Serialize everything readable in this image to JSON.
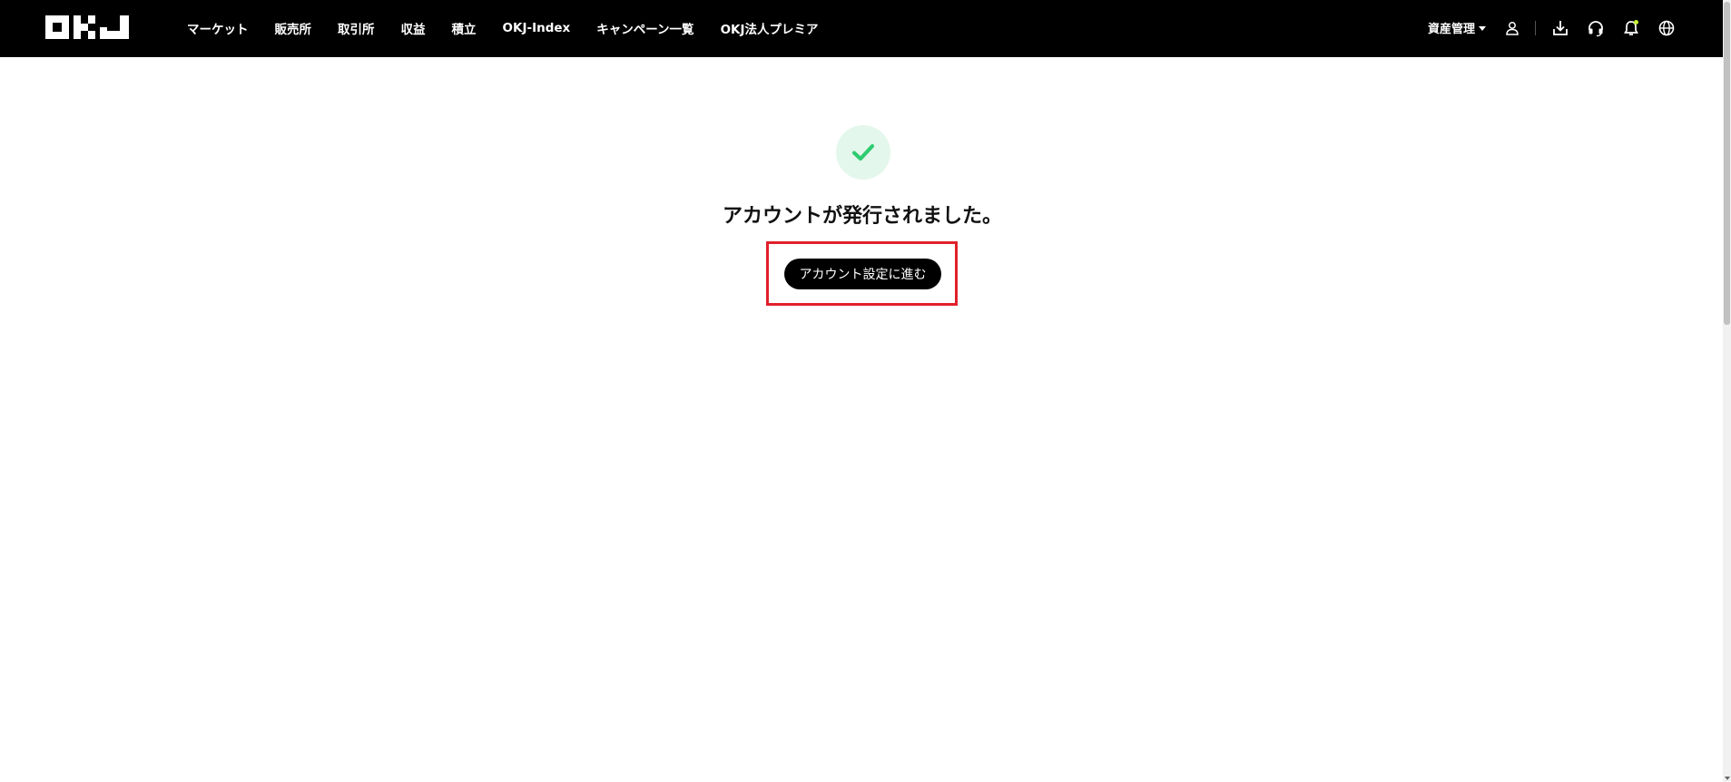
{
  "header": {
    "logo_icon": "okj-logo",
    "nav": [
      {
        "label": "マーケット"
      },
      {
        "label": "販売所"
      },
      {
        "label": "取引所"
      },
      {
        "label": "収益"
      },
      {
        "label": "積立"
      },
      {
        "label": "OKJ-Index"
      },
      {
        "label": "キャンペーン一覧"
      },
      {
        "label": "OKJ法人プレミア"
      }
    ],
    "asset_menu_label": "資産管理",
    "icons": [
      "user-icon",
      "download-icon",
      "headset-icon",
      "bell-icon",
      "globe-icon"
    ],
    "notification_dot_color": "#c6f432"
  },
  "main": {
    "success_icon": "checkmark-icon",
    "success_color": "#2ecc71",
    "title": "アカウントが発行されました。",
    "cta_label": "アカウント設定に進む",
    "highlight_color": "#e0202a"
  }
}
